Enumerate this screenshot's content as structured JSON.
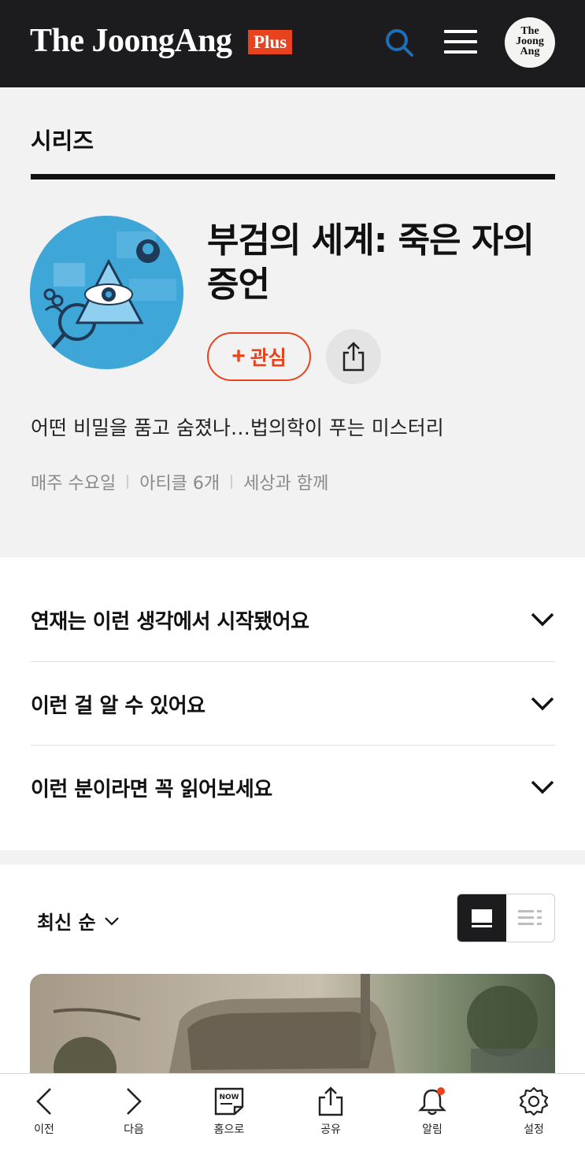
{
  "header": {
    "logo": "The JoongAng",
    "plus_badge": "Plus",
    "avatar_text_1": "The",
    "avatar_text_2": "Joong",
    "avatar_text_3": "Ang"
  },
  "series": {
    "section_label": "시리즈",
    "title": "부검의 세계: 죽은 자의 증언",
    "follow_label": "관심",
    "description": "어떤 비밀을 품고 숨졌나…법의학이 푸는 미스터리",
    "meta": [
      "매주 수요일",
      "아티클 6개",
      "세상과 함께"
    ]
  },
  "accordion": [
    {
      "label": "연재는 이런 생각에서 시작됐어요"
    },
    {
      "label": "이런 걸 알 수 있어요"
    },
    {
      "label": "이런 분이라면 꼭 읽어보세요"
    }
  ],
  "list": {
    "sort_label": "최신 순"
  },
  "bottom_nav": [
    {
      "label": "이전",
      "icon": "chevron-left-icon"
    },
    {
      "label": "다음",
      "icon": "chevron-right-icon"
    },
    {
      "label": "홈으로",
      "icon": "now-home-icon",
      "badge": "NOW"
    },
    {
      "label": "공유",
      "icon": "share-icon"
    },
    {
      "label": "알림",
      "icon": "bell-icon"
    },
    {
      "label": "설정",
      "icon": "gear-icon"
    }
  ],
  "colors": {
    "header_bg": "#1c1c1e",
    "accent": "#e8431c",
    "cover_blue": "#3fa6d8"
  }
}
